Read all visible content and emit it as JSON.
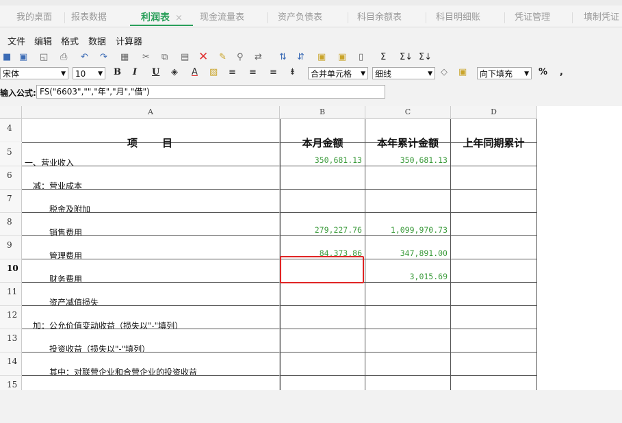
{
  "tabs": [
    {
      "label": "我的桌面",
      "active": false
    },
    {
      "label": "报表数据",
      "active": false
    },
    {
      "label": "利润表",
      "active": true,
      "close": "×"
    },
    {
      "label": "现金流量表",
      "active": false
    },
    {
      "label": "资产负债表",
      "active": false
    },
    {
      "label": "科目余额表",
      "active": false
    },
    {
      "label": "科目明细账",
      "active": false
    },
    {
      "label": "凭证管理",
      "active": false
    },
    {
      "label": "填制凭证",
      "active": false
    }
  ],
  "menu": [
    "文件",
    "编辑",
    "格式",
    "数据",
    "计算器"
  ],
  "format": {
    "font_name": "宋体",
    "font_size": "10",
    "bold": "B",
    "italic": "I",
    "underline": "U",
    "merge": "合并单元格",
    "border": "细线",
    "fill": "向下填充",
    "percent": "%",
    "comma": ","
  },
  "formula": {
    "label": "输入公式:",
    "value": "FS(\"6603\",\"\",\"年\",\"月\",\"借\")"
  },
  "columns": [
    "A",
    "B",
    "C",
    "D"
  ],
  "header_row": {
    "row": "4",
    "item": "项　　目",
    "month": "本月金额",
    "year": "本年累计金额",
    "prev": "上年同期累计"
  },
  "rows": [
    {
      "row": "5",
      "item": "一、营业收入",
      "month": "350,681.13",
      "year": "350,681.13",
      "prev": ""
    },
    {
      "row": "6",
      "item": "　减：营业成本",
      "month": "",
      "year": "",
      "prev": ""
    },
    {
      "row": "7",
      "item": "　　　税金及附加",
      "month": "",
      "year": "",
      "prev": ""
    },
    {
      "row": "8",
      "item": "　　　销售费用",
      "month": "279,227.76",
      "year": "1,099,970.73",
      "prev": ""
    },
    {
      "row": "9",
      "item": "　　　管理费用",
      "month": "84,373.86",
      "year": "347,891.00",
      "prev": ""
    },
    {
      "row": "10",
      "item": "　　　财务费用",
      "month": "",
      "year": "3,015.69",
      "prev": ""
    },
    {
      "row": "11",
      "item": "　　　资产减值损失",
      "month": "",
      "year": "",
      "prev": ""
    },
    {
      "row": "12",
      "item": "　加：公允价值变动收益（损失以\"-\"填列）",
      "month": "",
      "year": "",
      "prev": ""
    },
    {
      "row": "13",
      "item": "　　　投资收益（损失以\"-\"填列）",
      "month": "",
      "year": "",
      "prev": ""
    },
    {
      "row": "14",
      "item": "　　　其中：对联营企业和合营企业的投资收益",
      "month": "",
      "year": "",
      "prev": ""
    },
    {
      "row": "15",
      "item": "",
      "month": "",
      "year": "",
      "prev": ""
    }
  ]
}
